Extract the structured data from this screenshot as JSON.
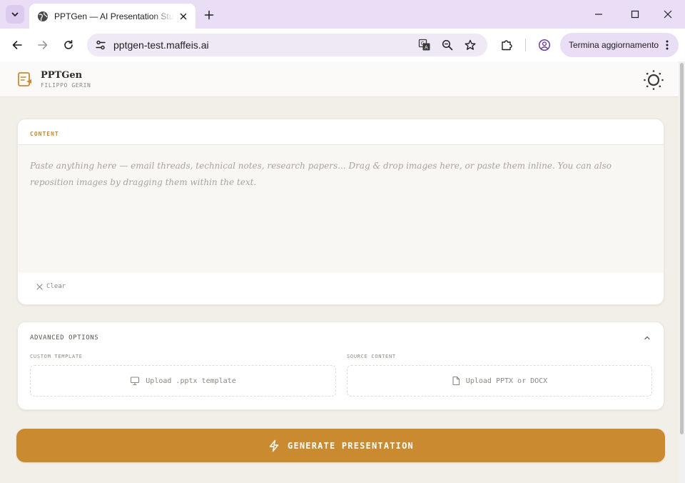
{
  "browser": {
    "tab_title": "PPTGen — AI Presentation Studio",
    "url": "pptgen-test.maffeis.ai",
    "update_button": "Termina aggiornamento"
  },
  "app": {
    "brand_name": "PPTGen",
    "brand_subtitle": "FILIPPO GERIN",
    "accent_color": "#c98a30"
  },
  "content": {
    "label": "CONTENT",
    "placeholder": "Paste anything here — email threads, technical notes, research papers... Drag & drop images here, or paste them inline. You can also reposition images by dragging them within the text.",
    "clear_label": "Clear"
  },
  "advanced": {
    "title": "ADVANCED OPTIONS",
    "custom_template_label": "CUSTOM TEMPLATE",
    "custom_template_button": "Upload .pptx template",
    "source_content_label": "SOURCE CONTENT",
    "source_content_button": "Upload PPTX or DOCX"
  },
  "generate": {
    "label": "GENERATE PRESENTATION"
  }
}
